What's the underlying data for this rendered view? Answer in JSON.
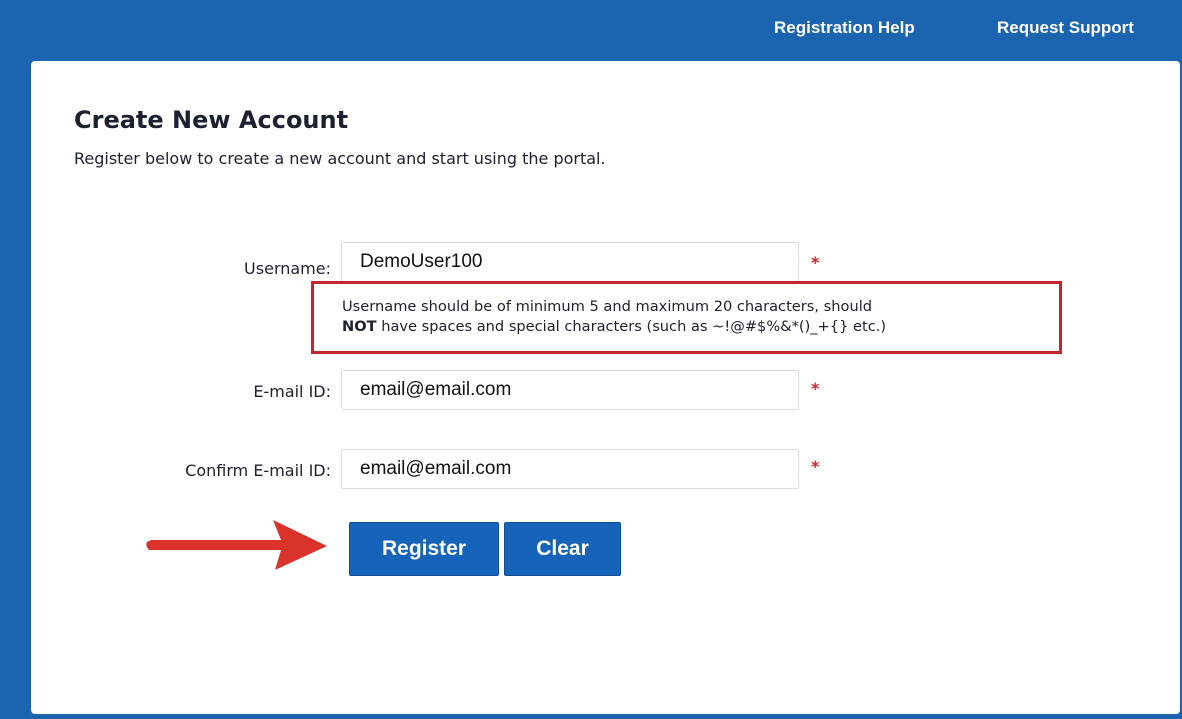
{
  "header": {
    "links": [
      "Registration Help",
      "Request Support"
    ]
  },
  "form": {
    "title": "Create New Account",
    "subtitle": "Register below to create a new account and start using the portal.",
    "fields": {
      "username": {
        "label": "Username:",
        "value": "DemoUser100",
        "required_mark": "*"
      },
      "email": {
        "label": "E-mail ID:",
        "value": "email@email.com",
        "required_mark": "*"
      },
      "confirm_email": {
        "label": "Confirm E-mail ID:",
        "value": "email@email.com",
        "required_mark": "*"
      }
    },
    "username_hint": {
      "line1": "Username should be of minimum 5 and maximum 20 characters, should",
      "line2_bold": "NOT",
      "line2_rest": " have spaces and special characters (such as ~!@#$%&*()_+{} etc.)"
    },
    "buttons": {
      "register": "Register",
      "clear": "Clear"
    }
  },
  "colors": {
    "header_bg": "#1a64b0",
    "button_bg": "#1564b9",
    "required": "#d4242b",
    "hint_border": "#c4262e",
    "arrow": "#d9332b"
  },
  "annotation_icon": "right-arrow-icon"
}
